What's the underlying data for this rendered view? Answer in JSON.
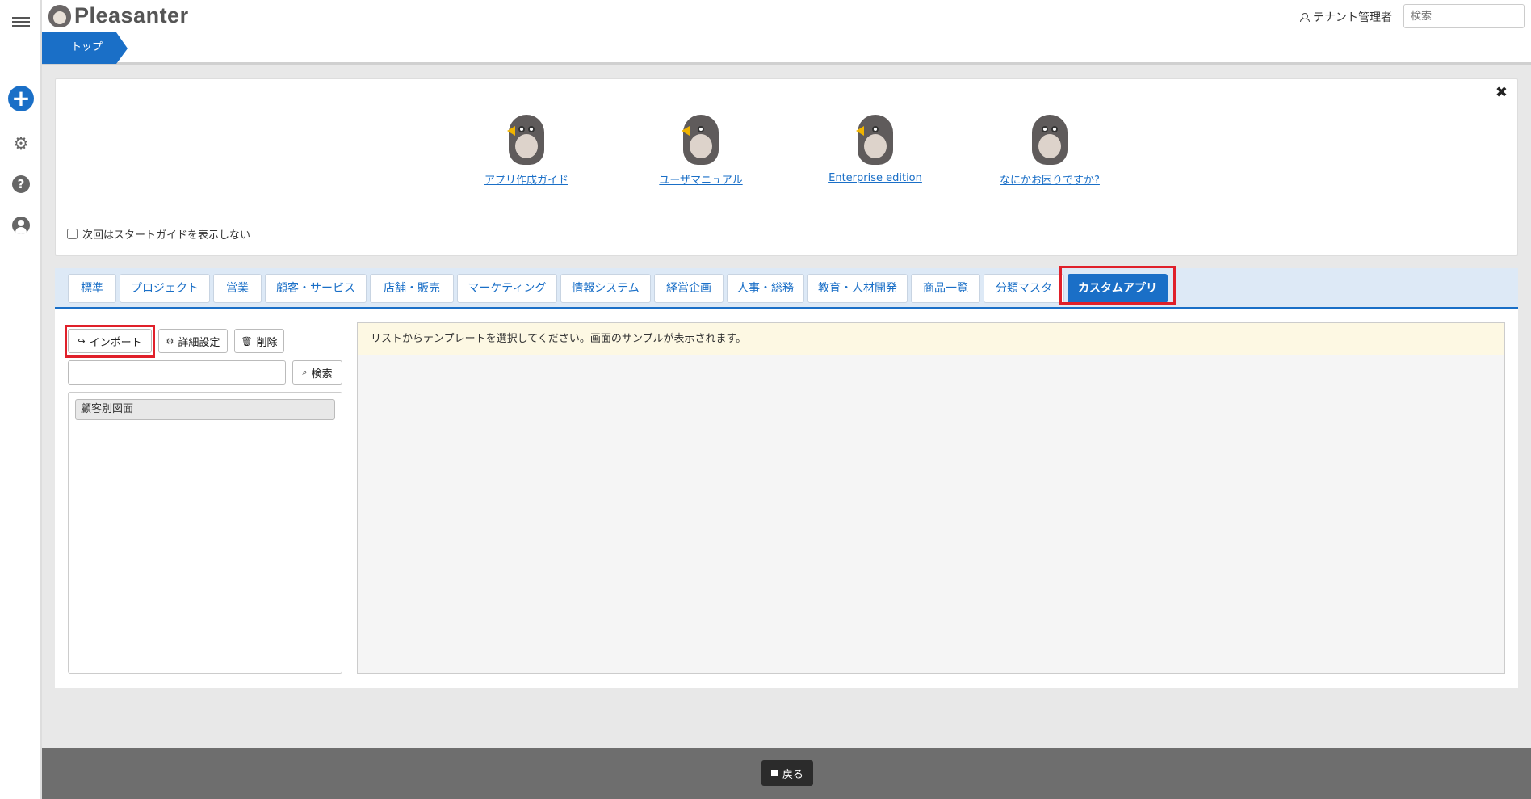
{
  "app": {
    "name": "Pleasanter"
  },
  "header": {
    "user_name": "テナント管理者",
    "search_placeholder": "検索"
  },
  "breadcrumb": {
    "items": [
      "トップ"
    ]
  },
  "start_guide": {
    "items": [
      {
        "label": "アプリ作成ガイド"
      },
      {
        "label": "ユーザマニュアル"
      },
      {
        "label": "Enterprise edition"
      },
      {
        "label": "なにかお困りですか?"
      }
    ],
    "checkbox_label": "次回はスタートガイドを表示しない",
    "checkbox_checked": false
  },
  "tabs": [
    {
      "label": "標準"
    },
    {
      "label": "プロジェクト"
    },
    {
      "label": "営業"
    },
    {
      "label": "顧客・サービス"
    },
    {
      "label": "店舗・販売"
    },
    {
      "label": "マーケティング"
    },
    {
      "label": "情報システム"
    },
    {
      "label": "経営企画"
    },
    {
      "label": "人事・総務"
    },
    {
      "label": "教育・人材開発"
    },
    {
      "label": "商品一覧"
    },
    {
      "label": "分類マスタ"
    },
    {
      "label": "カスタムアプリ",
      "active": true
    }
  ],
  "toolbar": {
    "import_label": "インポート",
    "detail_label": "詳細設定",
    "delete_label": "削除",
    "search_label": "検索"
  },
  "template_list": {
    "items": [
      "顧客別図面"
    ]
  },
  "preview": {
    "message": "リストからテンプレートを選択してください。画面のサンプルが表示されます。"
  },
  "footer": {
    "back_label": "戻る"
  },
  "colors": {
    "accent": "#1a6fc7",
    "highlight": "#e0202a",
    "footer": "#6e6e6e"
  }
}
